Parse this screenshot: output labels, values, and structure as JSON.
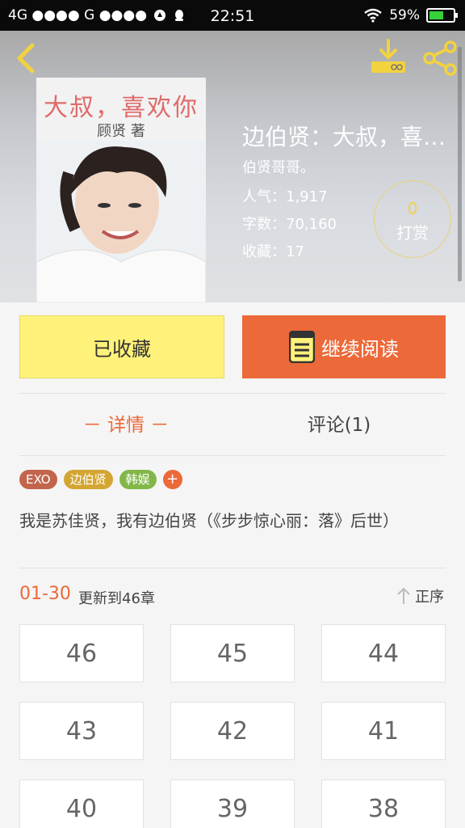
{
  "status": {
    "carrier": "4G ●●●● G ●●●●",
    "time": "22:51",
    "battery": "59%",
    "battery_level": 0.59
  },
  "header": {
    "cover": {
      "title": "大叔，喜欢你",
      "author": "顾贤 著"
    },
    "title": "边伯贤：大叔，喜…",
    "author": "伯贤哥哥。",
    "popularity": "人气：1,917",
    "words": "字数：70,160",
    "favorites": "收藏：17",
    "reward_count": "0",
    "reward_label": "打赏"
  },
  "actions": {
    "collected_label": "已收藏",
    "read_label": "继续阅读"
  },
  "tabs": {
    "detail": "－ 详情 －",
    "comments": "评论(1)"
  },
  "tags": [
    {
      "label": "EXO",
      "color": "#c2654c"
    },
    {
      "label": "边伯贤",
      "color": "#d3a632"
    },
    {
      "label": "韩娱",
      "color": "#82b748"
    },
    {
      "label": "+",
      "color": "#ec6939"
    }
  ],
  "description": "我是苏佳贤，我有边伯贤（《步步惊心丽：落》后世）",
  "chapters": {
    "range": "01-30",
    "update": "更新到46章",
    "sort_label": "正序",
    "items": [
      "46",
      "45",
      "44",
      "43",
      "42",
      "41",
      "40",
      "39",
      "38"
    ]
  },
  "colors": {
    "accent": "#ec6939",
    "collect_bg": "#fff27a"
  }
}
